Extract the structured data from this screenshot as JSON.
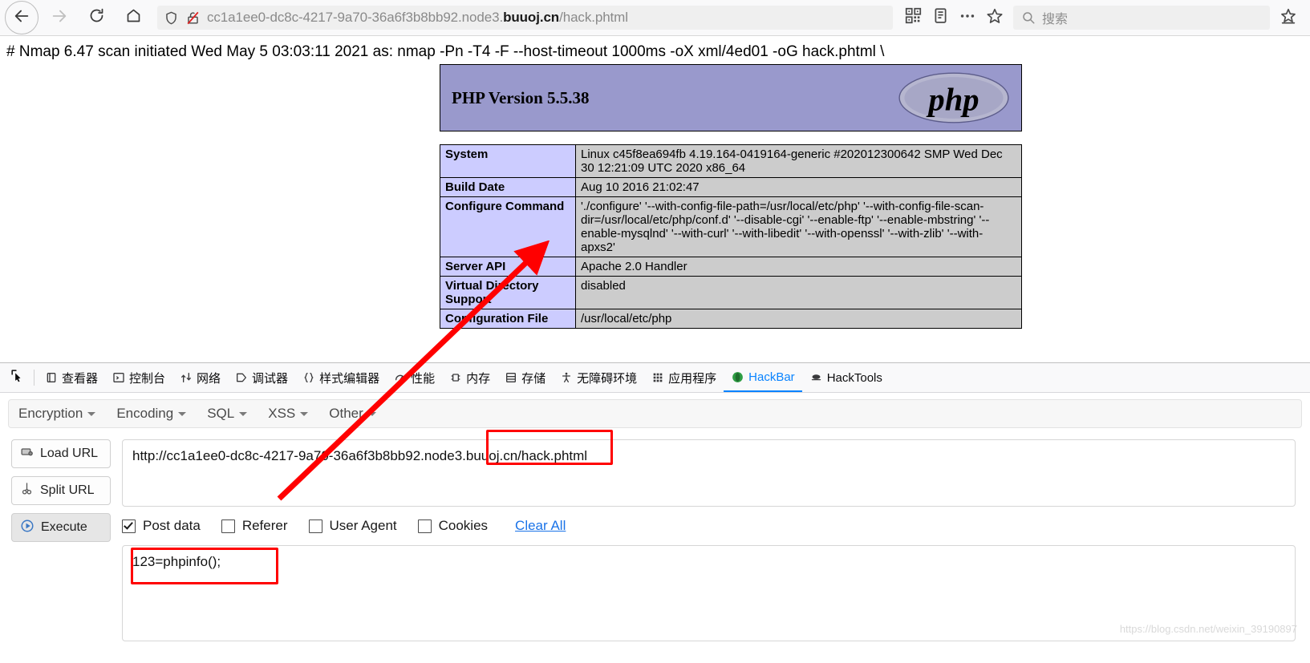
{
  "browser": {
    "back_icon": "back-arrow-icon",
    "forward_icon": "forward-arrow-icon",
    "reload_icon": "reload-icon",
    "home_icon": "home-icon",
    "shield_icon": "shield-icon",
    "lock_broken_icon": "broken-lock-icon",
    "url_prefix": "cc1a1ee0-dc8c-4217-9a70-36a6f3b8bb92.node3.",
    "url_domain": "buuoj.cn",
    "url_suffix": "/hack.phtml",
    "qrcode_icon": "qrcode-icon",
    "reader_icon": "reader-mode-icon",
    "overflow_icon": "more-options-icon",
    "bookmark_icon": "star-bookmark-icon",
    "search_icon": "search-icon",
    "search_placeholder": "搜索",
    "save_page_icon": "save-to-pocket-icon"
  },
  "nmap_line": "# Nmap 6.47 scan initiated Wed May 5 03:03:11 2021 as: nmap -Pn -T4 -F --host-timeout 1000ms -oX xml/4ed01 -oG hack.phtml \\",
  "phpinfo": {
    "version_title": "PHP Version 5.5.38",
    "logo_text": "php",
    "rows": [
      {
        "key": "System",
        "value": "Linux c45f8ea694fb 4.19.164-0419164-generic #202012300642 SMP Wed Dec 30 12:21:09 UTC 2020 x86_64"
      },
      {
        "key": "Build Date",
        "value": "Aug 10 2016 21:02:47"
      },
      {
        "key": "Configure Command",
        "value": "'./configure' '--with-config-file-path=/usr/local/etc/php' '--with-config-file-scan-dir=/usr/local/etc/php/conf.d' '--disable-cgi' '--enable-ftp' '--enable-mbstring' '--enable-mysqlnd' '--with-curl' '--with-libedit' '--with-openssl' '--with-zlib' '--with-apxs2'"
      },
      {
        "key": "Server API",
        "value": "Apache 2.0 Handler"
      },
      {
        "key": "Virtual Directory Support",
        "value": "disabled"
      },
      {
        "key": "Configuration File",
        "value": "/usr/local/etc/php"
      }
    ]
  },
  "devtools": {
    "picker_icon": "element-picker-icon",
    "tabs": [
      {
        "label": "查看器",
        "icon": "inspector-icon",
        "active": false
      },
      {
        "label": "控制台",
        "icon": "console-icon",
        "active": false
      },
      {
        "label": "网络",
        "icon": "network-icon",
        "active": false
      },
      {
        "label": "调试器",
        "icon": "debugger-icon",
        "active": false
      },
      {
        "label": "样式编辑器",
        "icon": "style-editor-icon",
        "active": false
      },
      {
        "label": "性能",
        "icon": "performance-icon",
        "active": false
      },
      {
        "label": "内存",
        "icon": "memory-icon",
        "active": false
      },
      {
        "label": "存储",
        "icon": "storage-icon",
        "active": false
      },
      {
        "label": "无障碍环境",
        "icon": "accessibility-icon",
        "active": false
      },
      {
        "label": "应用程序",
        "icon": "application-icon",
        "active": false
      },
      {
        "label": "HackBar",
        "icon": "hackbar-icon",
        "active": true
      },
      {
        "label": "HackTools",
        "icon": "hacktools-icon",
        "active": false
      }
    ]
  },
  "hackbar": {
    "menus": [
      {
        "label": "Encryption"
      },
      {
        "label": "Encoding"
      },
      {
        "label": "SQL"
      },
      {
        "label": "XSS"
      },
      {
        "label": "Other"
      }
    ],
    "buttons": [
      {
        "label": "Load URL",
        "icon": "load-url-icon",
        "pressed": false
      },
      {
        "label": "Split URL",
        "icon": "split-url-icon",
        "pressed": false
      },
      {
        "label": "Execute",
        "icon": "execute-icon",
        "pressed": true
      }
    ],
    "url_value": "http://cc1a1ee0-dc8c-4217-9a70-36a6f3b8bb92.node3.buuoj.cn/hack.phtml",
    "options": [
      {
        "label": "Post data",
        "checked": true
      },
      {
        "label": "Referer",
        "checked": false
      },
      {
        "label": "User Agent",
        "checked": false
      },
      {
        "label": "Cookies",
        "checked": false
      }
    ],
    "clear_all_label": "Clear All",
    "post_data_value": "123=phpinfo();"
  },
  "annotations": {
    "highlight_url_fragment": "uoj.cn/hack.phtml",
    "highlight_post_data": "123=phpinfo();",
    "arrow": "red-arrow-pointing-to-configure-command"
  },
  "watermark": "https://blog.csdn.net/weixin_39190897"
}
